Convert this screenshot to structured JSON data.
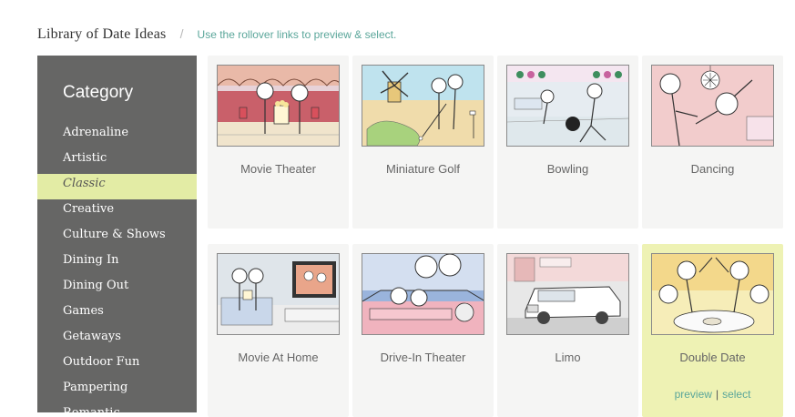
{
  "header": {
    "title": "Library of Date Ideas",
    "separator": "/",
    "hint": "Use the rollover links to preview & select."
  },
  "sidebar": {
    "heading": "Category",
    "items": [
      {
        "label": "Adrenaline"
      },
      {
        "label": "Artistic"
      },
      {
        "label": "Classic",
        "active": true
      },
      {
        "label": "Creative"
      },
      {
        "label": "Culture & Shows"
      },
      {
        "label": "Dining In"
      },
      {
        "label": "Dining Out"
      },
      {
        "label": "Games"
      },
      {
        "label": "Getaways"
      },
      {
        "label": "Outdoor Fun"
      },
      {
        "label": "Pampering"
      },
      {
        "label": "Romantic"
      }
    ]
  },
  "tiles": [
    {
      "label": "Movie Theater",
      "thumb_bg": "#e7d2d8"
    },
    {
      "label": "Miniature Golf",
      "thumb_bg": "#bfe3ee"
    },
    {
      "label": "Bowling",
      "thumb_bg": "#e6ecf1"
    },
    {
      "label": "Dancing",
      "thumb_bg": "#f2cccc"
    },
    {
      "label": "Movie At Home",
      "thumb_bg": "#dfe5ea"
    },
    {
      "label": "Drive-In Theater",
      "thumb_bg": "#9ab4dc"
    },
    {
      "label": "Limo",
      "thumb_bg": "#e8e8e8"
    },
    {
      "label": "Double Date",
      "thumb_bg": "#f6edb8",
      "selected": true
    }
  ],
  "tile_actions": {
    "preview": "preview",
    "separator": "|",
    "select": "select"
  }
}
